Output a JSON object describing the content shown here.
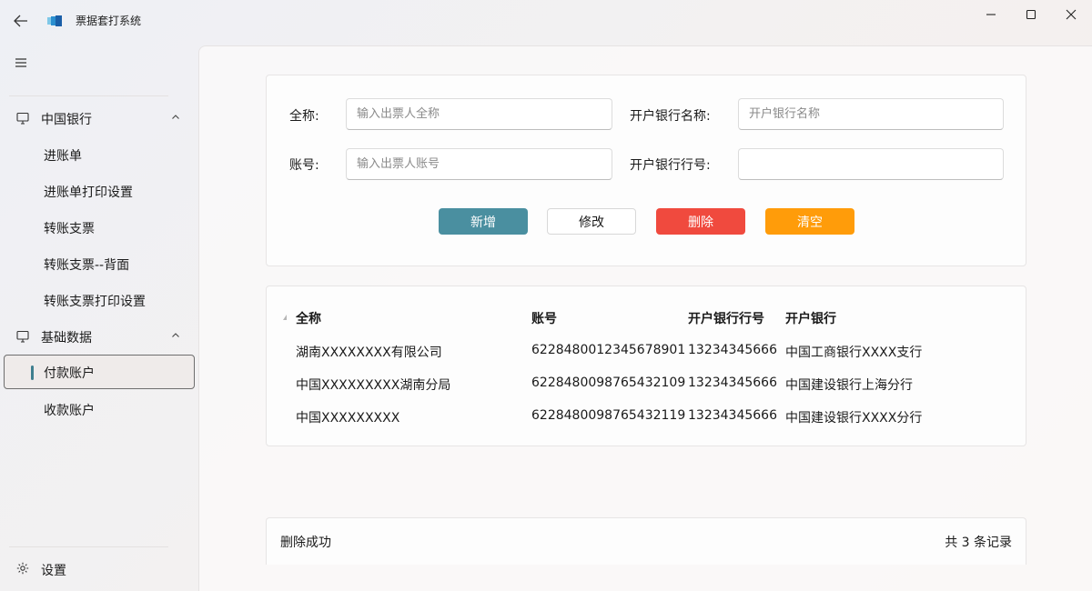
{
  "app": {
    "title": "票据套打系统"
  },
  "sidebar": {
    "groups": [
      {
        "label": "中国银行",
        "items": [
          {
            "label": "进账单"
          },
          {
            "label": "进账单打印设置"
          },
          {
            "label": "转账支票"
          },
          {
            "label": "转账支票--背面"
          },
          {
            "label": "转账支票打印设置"
          }
        ]
      },
      {
        "label": "基础数据",
        "items": [
          {
            "label": "付款账户"
          },
          {
            "label": "收款账户"
          }
        ]
      }
    ],
    "active_item": "付款账户",
    "settings_label": "设置"
  },
  "form": {
    "name_label": "全称:",
    "name_placeholder": "输入出票人全称",
    "name_value": "",
    "bank_name_label": "开户银行名称:",
    "bank_name_placeholder": "开户银行名称",
    "bank_name_value": "",
    "account_label": "账号:",
    "account_placeholder": "输入出票人账号",
    "account_value": "",
    "bank_code_label": "开户银行行号:",
    "bank_code_placeholder": "",
    "bank_code_value": ""
  },
  "buttons": {
    "add": "新增",
    "edit": "修改",
    "delete": "删除",
    "clear": "清空",
    "colors": {
      "add": "#4a8fa0",
      "delete": "#f04a3e",
      "clear": "#ff9c0a"
    }
  },
  "table": {
    "headers": [
      "全称",
      "账号",
      "开户银行行号",
      "开户银行"
    ],
    "rows": [
      [
        "湖南XXXXXXXX有限公司",
        "6228480012345678901",
        "13234345666",
        "中国工商银行XXXX支行"
      ],
      [
        "中国XXXXXXXXX湖南分局",
        "6228480098765432109",
        "13234345666",
        "中国建设银行上海分行"
      ],
      [
        "中国XXXXXXXXX",
        "6228480098765432119",
        "13234345666",
        "中国建设银行XXXX分行"
      ]
    ]
  },
  "status": {
    "message": "删除成功",
    "record_count": "共 3 条记录"
  }
}
